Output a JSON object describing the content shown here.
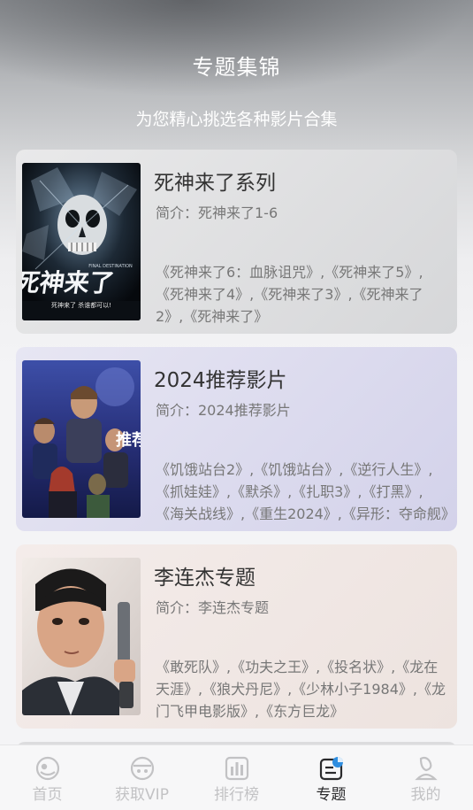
{
  "header": {
    "title": "专题集锦",
    "subtitle": "为您精心挑选各种影片合集"
  },
  "topics": [
    {
      "title": "死神来了系列",
      "intro": "简介：死神来了1-6",
      "films": "《死神来了6：血脉诅咒》,《死神来了5》,《死神来了4》,《死神来了3》,《死神来了2》,《死神来了》",
      "poster_text": "死神来了",
      "poster_caption": "死神来了 杀谁都可以!",
      "poster_brand": "FINAL DESTINATION"
    },
    {
      "title": "2024推荐影片",
      "intro": "简介：2024推荐影片",
      "films": "《饥饿站台2》,《饥饿站台》,《逆行人生》,《抓娃娃》,《默杀》,《扎职3》,《打黑》,《海关战线》,《重生2024》,《异形：夺命舰》",
      "poster_text": "推荐"
    },
    {
      "title": "李连杰专题",
      "intro": "简介：李连杰专题",
      "films": "《敢死队》,《功夫之王》,《投名状》,《龙在天涯》,《狼犬丹尼》,《少林小子1984》,《龙门飞甲电影版》,《东方巨龙》"
    }
  ],
  "tabbar": {
    "items": [
      {
        "label": "首页",
        "icon": "home-icon",
        "active": false
      },
      {
        "label": "获取VIP",
        "icon": "vip-icon",
        "active": false
      },
      {
        "label": "排行榜",
        "icon": "ranking-icon",
        "active": false
      },
      {
        "label": "专题",
        "icon": "topic-icon",
        "active": true
      },
      {
        "label": "我的",
        "icon": "profile-icon",
        "active": false
      }
    ]
  },
  "colors": {
    "accent": "#2f8ee0",
    "tab_inactive": "#c2c2c4",
    "tab_active": "#2a2a2c"
  }
}
